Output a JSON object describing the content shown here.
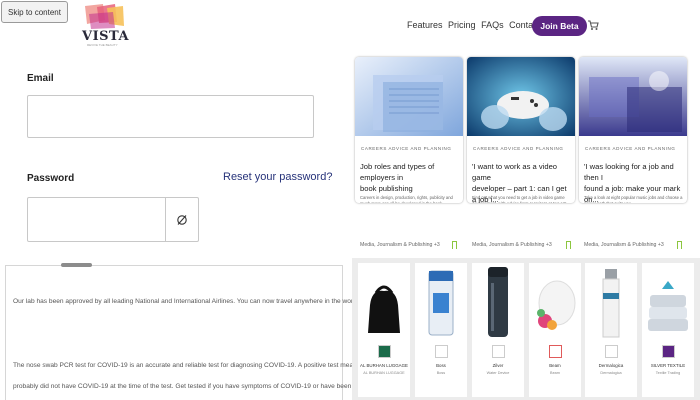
{
  "skip_link": "Skip to content",
  "logo": {
    "word": "VISTA",
    "tagline": "REVIVE THE BEAUTY"
  },
  "form": {
    "email_label": "Email",
    "email_value": "",
    "password_label": "Password",
    "password_value": "",
    "reset_link": "Reset your password?"
  },
  "notice": {
    "line1": "Our lab has been approved by all leading National and International Airlines. You can now travel anywhere in the world, with our verified Pre-Flight Covid-19 test.",
    "line2": "The nose swab PCR test for COVID-19 is an accurate and reliable test for diagnosing COVID-19. A positive test means you likely have COVID-19. A negative test means you",
    "line3": "probably did not have COVID-19 at the time of the test. Get tested if you have symptoms of COVID-19 or have been exposed to someone who tested positive for COVID-19."
  },
  "nav": {
    "items": [
      "Features",
      "Pricing",
      "FAQs",
      "Contact"
    ],
    "cta": "Join Beta",
    "cart_icon": "cart-icon"
  },
  "cards": [
    {
      "category": "CAREERS ADVICE AND PLANNING",
      "title_line1": "Job roles and types of employers in",
      "title_line2": "book publishing",
      "desc": "Careers in design, production, rights, publicity and much more can all be developed in the book publishing world. We explain what each role involves...",
      "meta": "Media, Journalism & Publishing +3"
    },
    {
      "category": "CAREERS ADVICE AND PLANNING",
      "title_line1": "'I want to work as a video game",
      "title_line2": "developer – part 1: can I get a job i...",
      "desc": "Find out what you need to get a job in video game development, with advice from recruiters at two UK game development studios.",
      "meta": "Media, Journalism & Publishing +3"
    },
    {
      "category": "CAREERS ADVICE AND PLANNING",
      "title_line1": "'I was looking for a job and then I",
      "title_line2": "found a job: make your mark on...",
      "desc": "Take a look at eight popular music jobs and choose a career path that suits you.",
      "meta": "Media, Journalism & Publishing +3"
    }
  ],
  "products": [
    {
      "name": "AL BURHAN LUGGAGE",
      "brand": "AL BURHAN LUGGAGE"
    },
    {
      "name": "Boss",
      "brand": "Boss"
    },
    {
      "name": "Zilver",
      "brand": "Water Device"
    },
    {
      "name": "Beam",
      "brand": "Beam"
    },
    {
      "name": "Dermalogica",
      "brand": "Dermalogica"
    },
    {
      "name": "SILVER TEXTILE",
      "brand": "Textile Trading"
    }
  ],
  "colors": {
    "brand_purple": "#5b2583",
    "link_navy": "#27337a",
    "bookmark_green": "#8cc63f"
  }
}
